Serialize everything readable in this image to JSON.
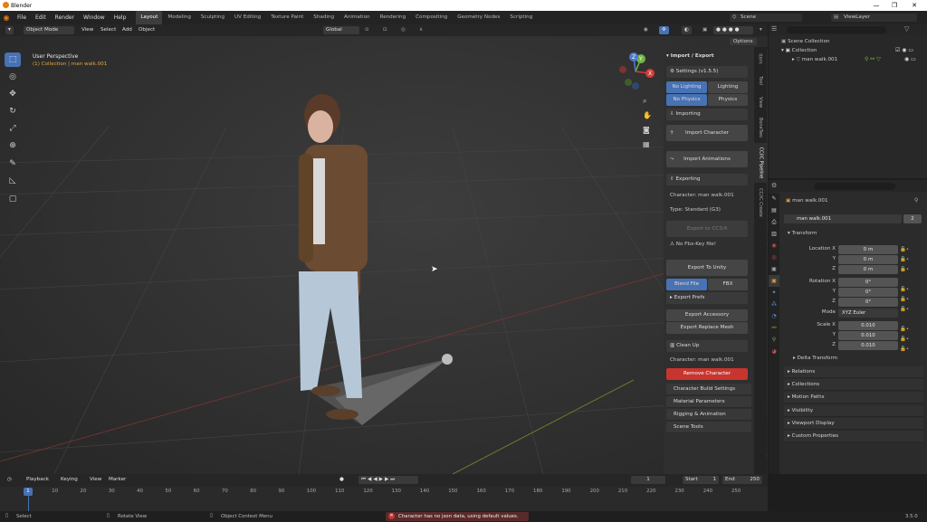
{
  "window": {
    "title": "Blender",
    "minimize": "—",
    "maximize": "❐",
    "close": "✕"
  },
  "menu": [
    "File",
    "Edit",
    "Render",
    "Window",
    "Help"
  ],
  "workspaces": [
    "Layout",
    "Modeling",
    "Sculpting",
    "UV Editing",
    "Texture Paint",
    "Shading",
    "Animation",
    "Rendering",
    "Compositing",
    "Geometry Nodes",
    "Scripting"
  ],
  "scene": {
    "label": "Scene",
    "view_layer": "ViewLayer"
  },
  "header3d": {
    "mode": "Object Mode",
    "view": "View",
    "select": "Select",
    "add": "Add",
    "object": "Object",
    "orientation": "Global",
    "options": "Options"
  },
  "viewport": {
    "perspective": "User Perspective",
    "collection_info": "(1) Collection | man walk.001"
  },
  "gizmo": {
    "x": "X",
    "y": "Y",
    "z": "Z"
  },
  "colors": {
    "accent": "#4772b3",
    "danger": "#c8352e",
    "selected_text": "#e3a83b",
    "gizmo_x": "#d43c3c",
    "gizmo_y": "#6fb843",
    "gizmo_z": "#4c7ad1"
  },
  "npanel": {
    "import_export": "Import / Export",
    "settings": "Settings (v1.5.5)",
    "no_lighting": "No Lighting",
    "lighting": "Lighting",
    "no_physics": "No Physics",
    "physics": "Physics",
    "importing": "Importing",
    "import_character": "Import Character",
    "import_animations": "Import Animations",
    "exporting": "Exporting",
    "character": "Character: man walk.001",
    "type": "Type: Standard (G3)",
    "export_cc3": "Export to CC3/4",
    "no_fbx": "No Fbx-Key file!",
    "export_unity": "Export To Unity",
    "blend_file": "Blend File",
    "fbx": "FBX",
    "export_prefs": "Export Prefs",
    "export_accessory": "Export Accessory",
    "export_replace": "Export Replace Mesh",
    "clean_up": "Clean Up",
    "character2": "Character: man walk.001",
    "remove_character": "Remove Character",
    "build_settings": "Character Build Settings",
    "material_params": "Material Parameters",
    "rigging": "Rigging & Animation",
    "scene_tools": "Scene Tools"
  },
  "vtabs": [
    "Item",
    "Tool",
    "View",
    "BoneTwo",
    "CC/iC Pipeline",
    "CC/iC Create"
  ],
  "outliner": {
    "scene_collection": "Scene Collection",
    "collection": "Collection",
    "object": "man walk.001"
  },
  "properties": {
    "object_name": "man walk.001",
    "object_name2": "man walk.001",
    "users": "2",
    "transform": "Transform",
    "location_x": "Location X",
    "y": "Y",
    "z": "Z",
    "loc": [
      "0 m",
      "0 m",
      "0 m"
    ],
    "rotation_x": "Rotation X",
    "rot": [
      "0°",
      "0°",
      "0°"
    ],
    "mode_label": "Mode",
    "mode": "XYZ Euler",
    "scale_x": "Scale X",
    "scale": [
      "0.010",
      "0.010",
      "0.010"
    ],
    "delta": "Delta Transform",
    "sections": [
      "Relations",
      "Collections",
      "Motion Paths",
      "Visibility",
      "Viewport Display",
      "Custom Properties"
    ]
  },
  "timeline": {
    "playback": "Playback",
    "keying": "Keying",
    "view": "View",
    "marker": "Marker",
    "current": "1",
    "start_label": "Start",
    "start": "1",
    "end_label": "End",
    "end": "250",
    "ticks": [
      "0",
      "10",
      "20",
      "30",
      "40",
      "50",
      "60",
      "70",
      "80",
      "90",
      "100",
      "110",
      "120",
      "130",
      "140",
      "150",
      "160",
      "170",
      "180",
      "190",
      "200",
      "210",
      "220",
      "230",
      "240",
      "250"
    ],
    "frame": "1"
  },
  "status": {
    "select": "Select",
    "rotate": "Rotate View",
    "context": "Object Context Menu",
    "warning": "Character has no json data, using default values.",
    "version": "3.5.0"
  }
}
